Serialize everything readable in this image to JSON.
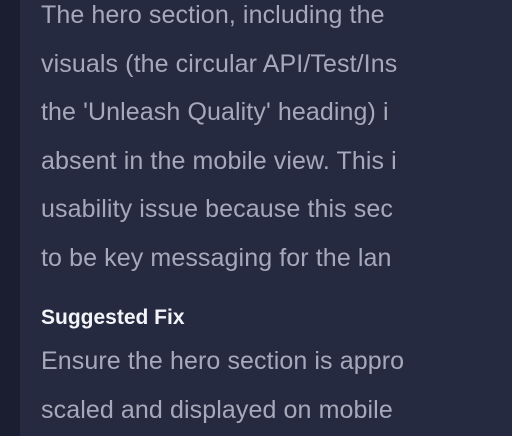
{
  "description_lines": [
    "The hero section, including the",
    "visuals (the circular API/Test/Ins",
    "the 'Unleash Quality' heading) i",
    "absent in the mobile view. This i",
    "usability issue because this sec",
    "to be key messaging for the lan"
  ],
  "suggested_fix": {
    "heading": "Suggested Fix",
    "lines": [
      "Ensure the hero section is appro",
      "scaled and displayed on mobile"
    ]
  }
}
